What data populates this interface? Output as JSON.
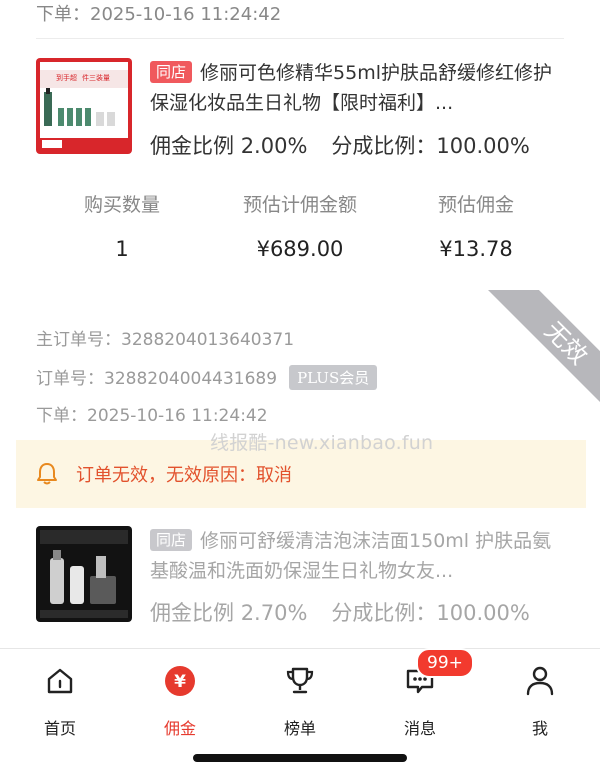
{
  "top_order": {
    "time_label": "下单：",
    "time_value": "2025-10-16 11:24:42"
  },
  "order1": {
    "shop_tag": "同店",
    "title": "修丽可色修精华55ml护肤品舒缓修红修护保湿化妆品生日礼物【限时福利】...",
    "commission_rate_label": "佣金比例",
    "commission_rate": "2.00%",
    "share_rate_label": "分成比例：",
    "share_rate": "100.00%",
    "stats": {
      "qty_label": "购买数量",
      "qty": "1",
      "est_amount_label": "预估计佣金额",
      "est_amount": "¥689.00",
      "est_commission_label": "预估佣金",
      "est_commission": "¥13.78"
    },
    "main_order_label": "主订单号：",
    "main_order_no": "3288204013640371",
    "order_label": "订单号：",
    "order_no": "3288204004431689",
    "plus_badge": "PLUS会员",
    "time_label": "下单：",
    "time_value": "2025-10-16 11:24:42",
    "ribbon_text": "无效",
    "notice": "订单无效，无效原因：取消",
    "image_texts": [
      "到手超",
      "件三装量"
    ]
  },
  "order2": {
    "shop_tag": "同店",
    "title": "修丽可舒缓清洁泡沫洁面150ml 护肤品氨基酸温和洗面奶保湿生日礼物女友...",
    "commission_rate_label": "佣金比例",
    "commission_rate": "2.70%",
    "share_rate_label": "分成比例：",
    "share_rate": "100.00%"
  },
  "watermark": "线报酷-new.xianbao.fun",
  "tabbar": {
    "tabs": [
      {
        "label": "首页",
        "icon": "home-icon"
      },
      {
        "label": "佣金",
        "icon": "yen-icon",
        "active": true
      },
      {
        "label": "榜单",
        "icon": "trophy-icon"
      },
      {
        "label": "消息",
        "icon": "message-icon"
      },
      {
        "label": "我",
        "icon": "user-icon"
      }
    ],
    "message_badge": "99+"
  },
  "colors": {
    "accent": "#e63a2e",
    "notice_bg": "#fdf6e3",
    "tag_red": "#f0595d"
  }
}
